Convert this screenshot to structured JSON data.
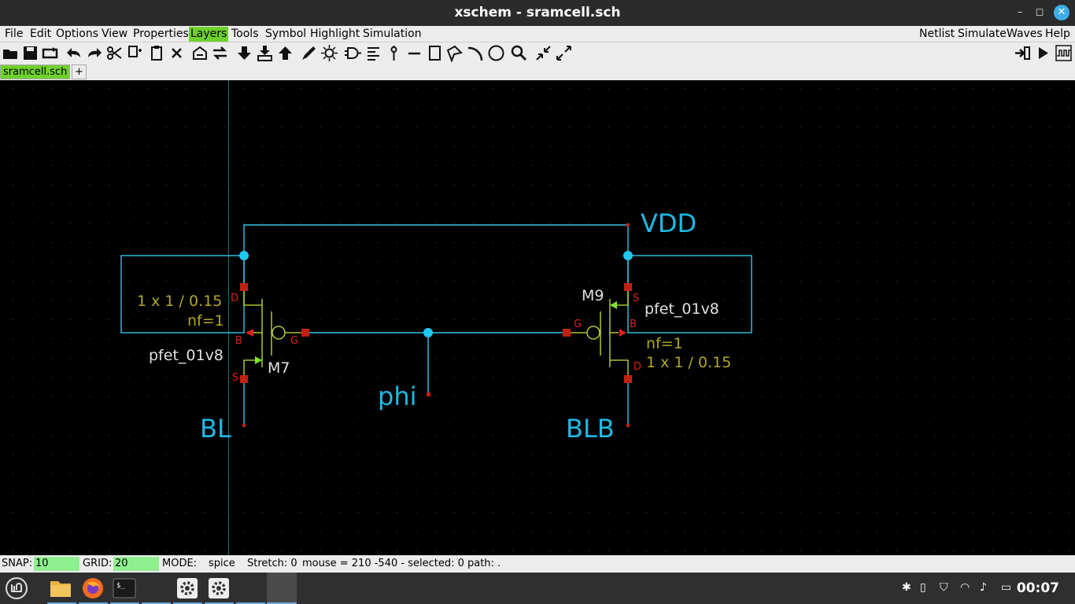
{
  "window": {
    "title": "xschem - sramcell.sch",
    "controls": {
      "minimize": "–",
      "maximize": "◻",
      "close": "✕"
    }
  },
  "menu": {
    "left": [
      "File",
      "Edit",
      "Options",
      "View",
      "Properties",
      "Layers",
      "Tools",
      "Symbol",
      "Highlight",
      "Simulation"
    ],
    "right": [
      "Netlist",
      "Simulate",
      "Waves",
      "Help"
    ],
    "active": "Layers"
  },
  "toolbar": {
    "icons": [
      "open-icon",
      "save-icon",
      "reload-icon",
      "undo-icon",
      "redo-icon",
      "cut-icon",
      "copy-icon",
      "paste-icon",
      "delete-icon",
      "push-icon",
      "pop-icon",
      "move-down-icon",
      "insert-symbol-icon",
      "move-up-icon",
      "draw-pen-icon",
      "highlight-icon",
      "symbol-gate-icon",
      "netlabel-icon",
      "pin-icon",
      "line-icon",
      "rect-icon",
      "polygon-icon",
      "arc-icon",
      "circle-icon",
      "zoom-icon",
      "zoom-in-icon",
      "zoom-out-icon",
      "netlist-icon",
      "simulate-icon",
      "waves-icon"
    ]
  },
  "tabs": {
    "active": "sramcell.sch",
    "add": "+"
  },
  "schematic": {
    "net_labels": {
      "vdd": "VDD",
      "bl": "BL",
      "blb": "BLB",
      "phi": "phi"
    },
    "m7": {
      "name": "M7",
      "model": "pfet_01v8",
      "size": "1 x 1 / 0.15",
      "nf": "nf=1",
      "pins": {
        "d": "D",
        "g": "G",
        "s": "S",
        "b": "B"
      }
    },
    "m9": {
      "name": "M9",
      "model": "pfet_01v8",
      "size": "1 x 1 / 0.15",
      "nf": "nf=1",
      "pins": {
        "d": "D",
        "g": "G",
        "s": "S",
        "b": "B"
      }
    },
    "colors": {
      "wire": "#36c6e8",
      "net_label": "#1fb9e3",
      "attr": "#b0a822",
      "pin_label": "#e02020",
      "pin": "#c02010",
      "device": "#c8e63a",
      "arrow": "#7ee62a",
      "text": "#e0e0e0",
      "grid": "#4a4a4a"
    }
  },
  "status": {
    "snap_label": "SNAP:",
    "snap": "10",
    "grid_label": "GRID:",
    "grid": "20",
    "mode_label": "MODE:",
    "mode": "spice",
    "stretch": "Stretch: 0",
    "mouse": "mouse = 210 -540 - selected: 0 path: ."
  },
  "taskbar": {
    "apps": [
      "mint-menu-icon",
      "files-icon",
      "firefox-icon",
      "terminal-icon",
      "settings-icon",
      "settings-icon-2"
    ],
    "tray": [
      "bluetooth-icon",
      "clipboard-icon",
      "shield-icon",
      "wifi-icon",
      "volume-icon",
      "battery-icon"
    ],
    "clock": "00:07"
  }
}
